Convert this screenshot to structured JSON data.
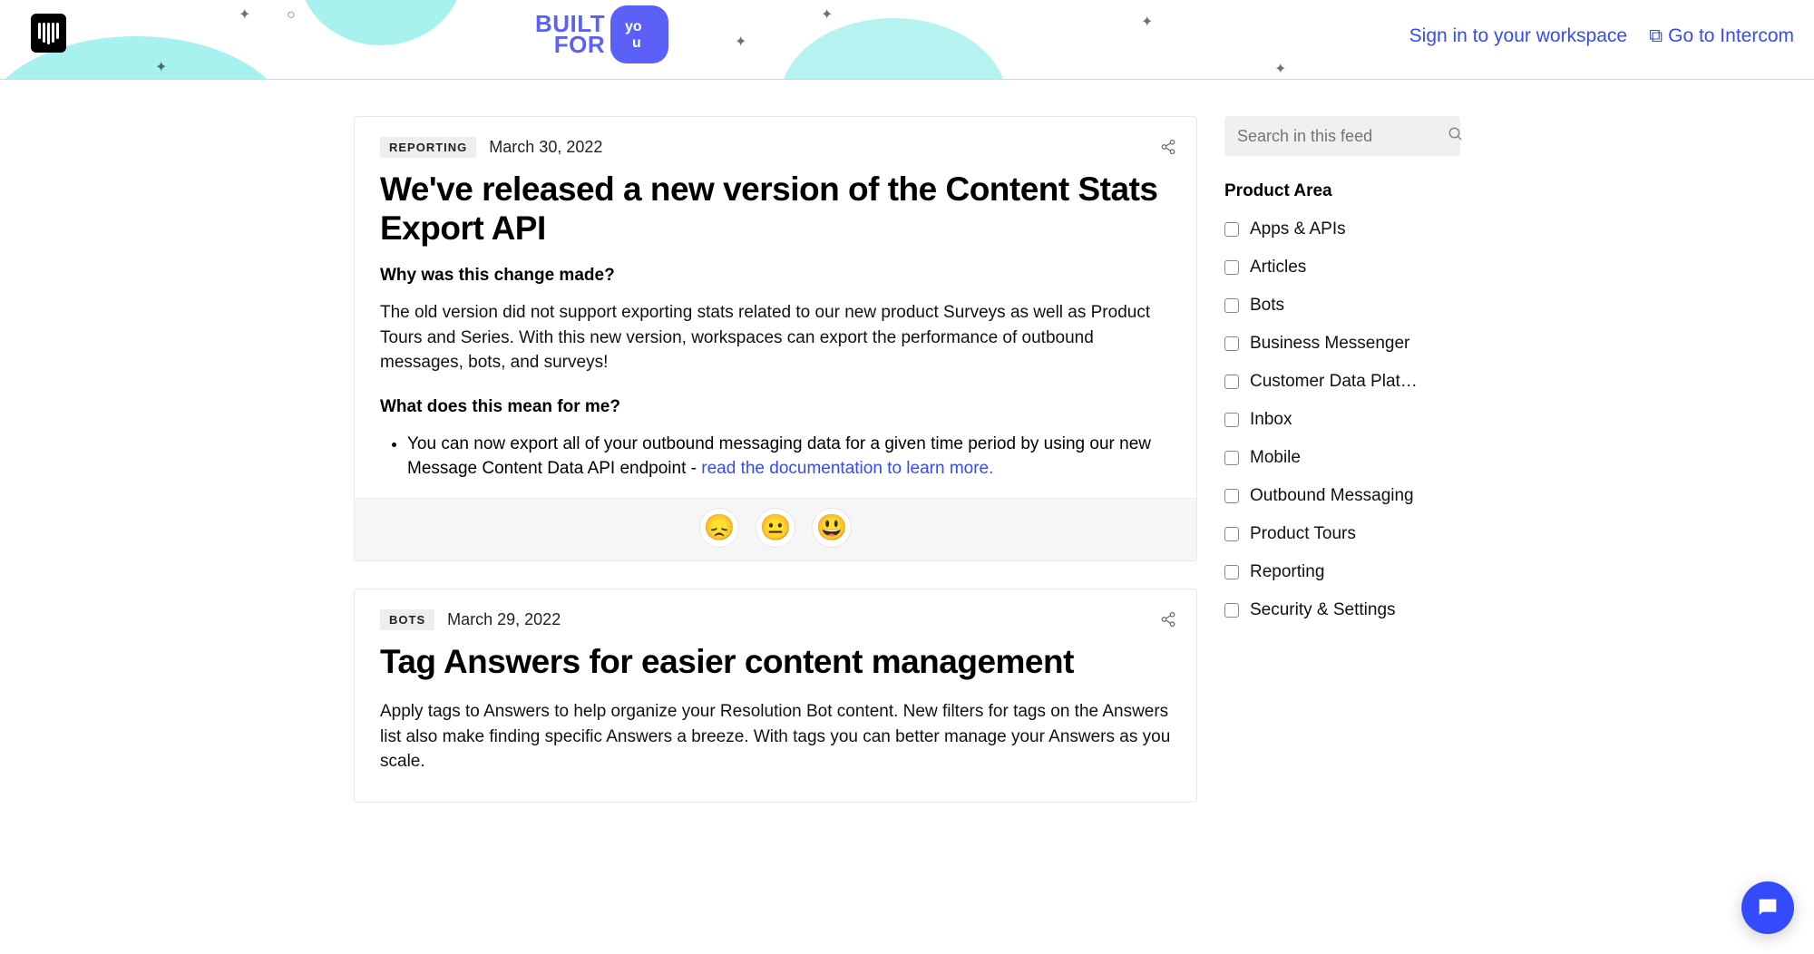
{
  "header": {
    "built": "BUILT",
    "for": "FOR",
    "badge": "yo\nu",
    "links": {
      "signin": "Sign in to your workspace",
      "goto": "Go to Intercom"
    }
  },
  "posts": [
    {
      "tag": "REPORTING",
      "date": "March 30, 2022",
      "title": "We've released a new version of the Content Stats Export API",
      "q1": "Why was this change made?",
      "p1": "The old version did not support exporting stats related to our new product Surveys as well as Product Tours and Series. With this new version, workspaces can export the performance of outbound messages, bots, and surveys!",
      "q2": "What does this mean for me?",
      "li1_a": "You can now export all of your outbound messaging data for a given time period by using our new Message Content Data API endpoint - ",
      "li1_link": "read the documentation to learn more."
    },
    {
      "tag": "BOTS",
      "date": "March 29, 2022",
      "title": "Tag Answers for easier content management",
      "p1": "Apply tags to Answers to help organize your Resolution Bot content. New filters for tags on the Answers list also make finding specific Answers a breeze. With tags you can better manage your Answers as you scale."
    }
  ],
  "reactions": {
    "sad": "😞",
    "neutral": "😐",
    "happy": "😃"
  },
  "sidebar": {
    "search_placeholder": "Search in this feed",
    "filter_heading": "Product Area",
    "filters": [
      "Apps & APIs",
      "Articles",
      "Bots",
      "Business Messenger",
      "Customer Data Platfo...",
      "Inbox",
      "Mobile",
      "Outbound Messaging",
      "Product Tours",
      "Reporting",
      "Security & Settings"
    ]
  }
}
